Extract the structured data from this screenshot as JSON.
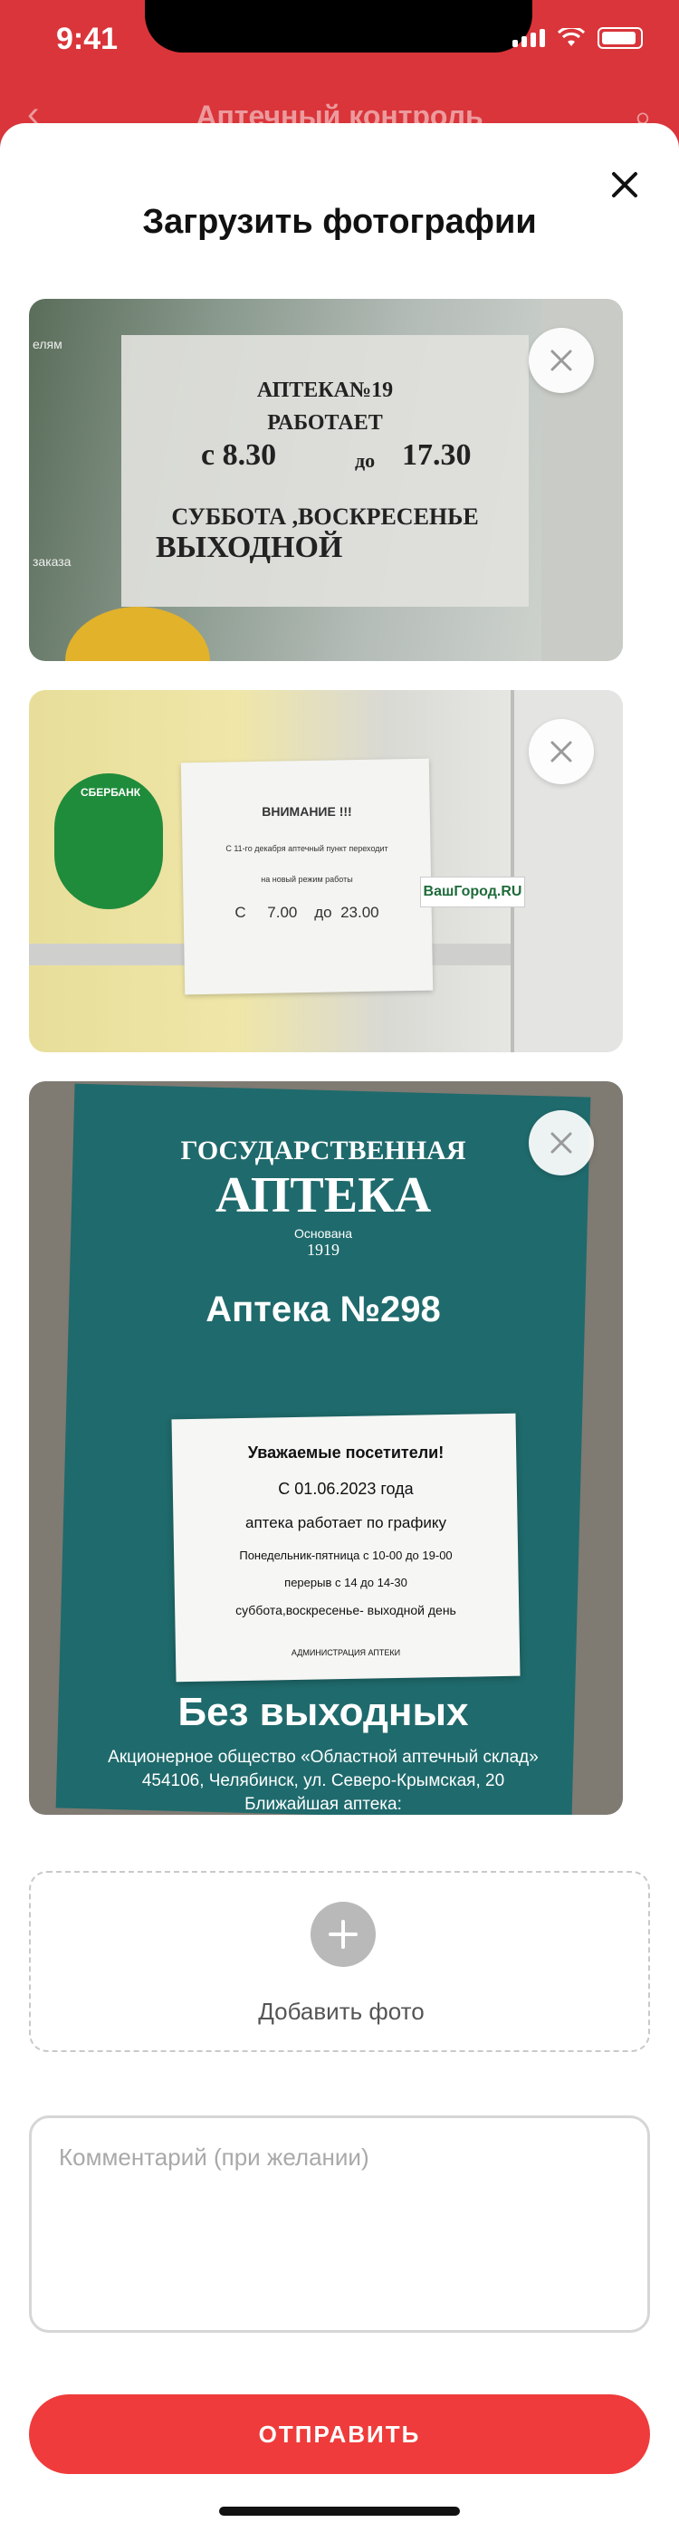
{
  "status_bar": {
    "time": "9:41"
  },
  "underlying_header": {
    "title": "Аптечный контроль",
    "back_glyph": "‹",
    "search_glyph": "⌕"
  },
  "modal": {
    "title": "Загрузить фотографии",
    "close_icon": "close-icon"
  },
  "photos": [
    {
      "remove_icon": "close-icon",
      "sign_lines": [
        "АПТЕКА№19",
        "РАБОТАЕТ",
        "с 8.30",
        "до",
        "17.30",
        "СУББОТА ,ВОСКРЕСЕНЬЕ",
        "ВЫХОДНОЙ"
      ],
      "edge_text": [
        "елям",
        "заказа"
      ]
    },
    {
      "remove_icon": "close-icon",
      "sign_lines": [
        "ВНИМАНИЕ !!!",
        "С 11-го декабря аптечный пункт переходит",
        "на новый режим работы",
        "С     7.00    до  23.00"
      ],
      "sticker_text": "ВашГород.RU",
      "badge_text": "СБЕРБАНК"
    },
    {
      "remove_icon": "close-icon",
      "board_lines": [
        "ГОСУДАРСТВЕННАЯ",
        "АПТЕКА",
        "Основана",
        "1919",
        "Аптека №298",
        "Без выходных",
        "Акционерное общество «Областной аптечный склад»",
        "454106, Челябинск, ул. Северо-Крымская, 20",
        "Ближайшая аптека:"
      ],
      "note_lines": [
        "Уважаемые посетители!",
        "С 01.06.2023 года",
        "аптека  работает по  графику",
        "Понедельник-пятница с 10-00 до 19-00",
        "перерыв с 14 до 14-30",
        "суббота,воскресенье- выходной день",
        "АДМИНИСТРАЦИЯ АПТЕКИ"
      ]
    }
  ],
  "add_photo": {
    "label": "Добавить фото"
  },
  "comment": {
    "placeholder": "Комментарий (при желании)",
    "value": ""
  },
  "submit": {
    "label": "ОТПРАВИТЬ"
  },
  "colors": {
    "accent": "#ef3b3b",
    "header_red": "#d9353a"
  }
}
